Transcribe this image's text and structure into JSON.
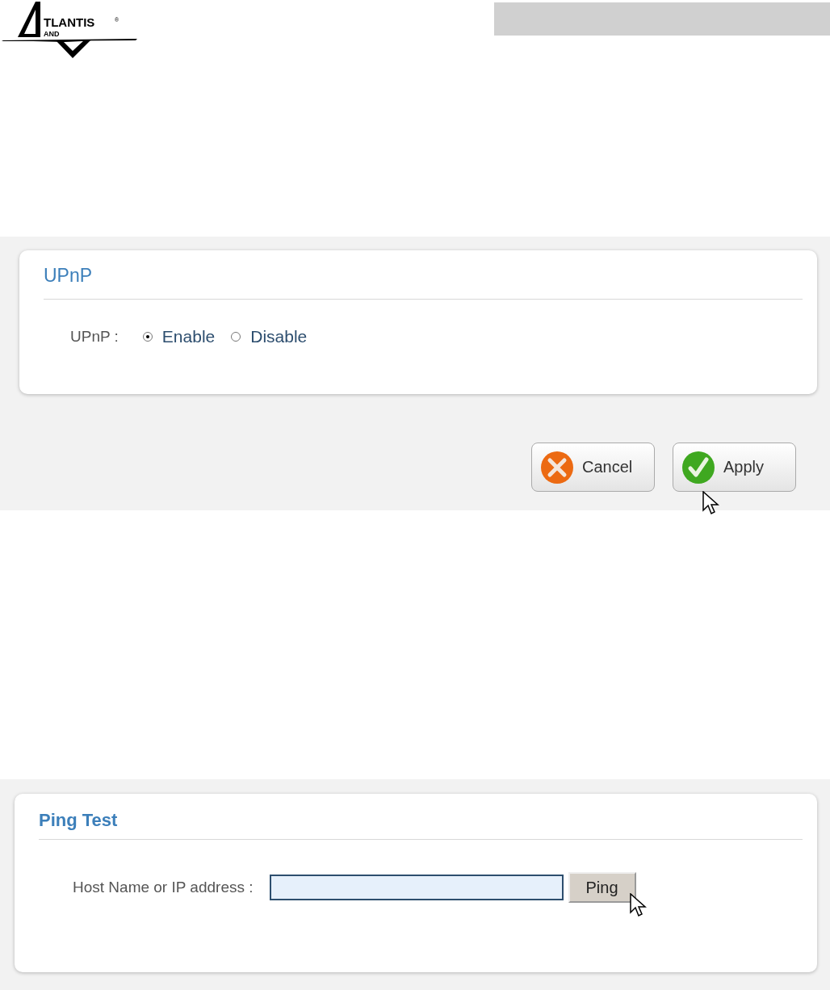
{
  "header": {
    "logo": {
      "main": "TLANTIS",
      "sub": "AND",
      "mark": "®"
    }
  },
  "upnp": {
    "title": "UPnP",
    "label": "UPnP :",
    "options": [
      {
        "label": "Enable",
        "selected": true
      },
      {
        "label": "Disable",
        "selected": false
      }
    ],
    "buttons": [
      {
        "kind": "cancel",
        "label": "Cancel"
      },
      {
        "kind": "apply",
        "label": "Apply"
      }
    ]
  },
  "ping": {
    "title": "Ping Test",
    "label": "Host Name or IP address :",
    "button": "Ping"
  }
}
